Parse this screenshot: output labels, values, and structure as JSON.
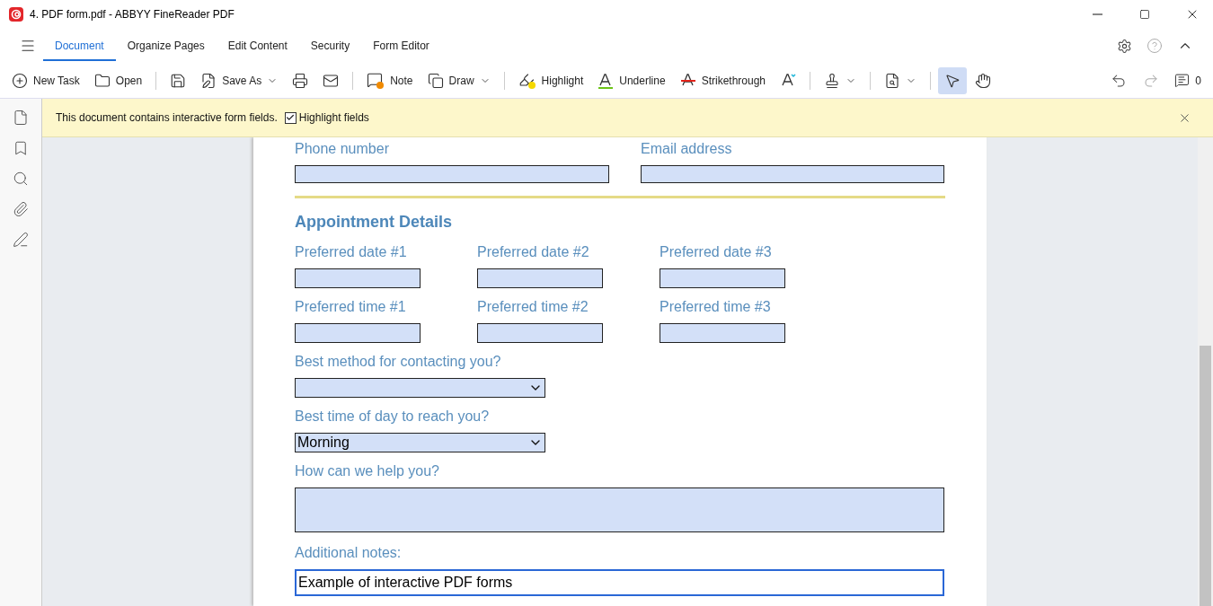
{
  "window": {
    "title": "4. PDF form.pdf - ABBYY FineReader PDF"
  },
  "tabs": [
    {
      "label": "Document",
      "selected": true
    },
    {
      "label": "Organize Pages",
      "selected": false
    },
    {
      "label": "Edit Content",
      "selected": false
    },
    {
      "label": "Security",
      "selected": false
    },
    {
      "label": "Form Editor",
      "selected": false
    }
  ],
  "toolbar": [
    {
      "kind": "button",
      "label": "New Task"
    },
    {
      "kind": "button",
      "label": "Open"
    },
    {
      "kind": "sep"
    },
    {
      "kind": "button"
    },
    {
      "kind": "button",
      "label": "Save As",
      "caret": true
    },
    {
      "kind": "button"
    },
    {
      "kind": "button"
    },
    {
      "kind": "sep"
    },
    {
      "kind": "button",
      "label": "Note"
    },
    {
      "kind": "button",
      "label": "Draw",
      "caret": true
    },
    {
      "kind": "sep"
    },
    {
      "kind": "button",
      "label": "Highlight"
    },
    {
      "kind": "button",
      "label": "Underline"
    },
    {
      "kind": "button",
      "label": "Strikethrough"
    },
    {
      "kind": "button"
    },
    {
      "kind": "sep"
    },
    {
      "kind": "button",
      "caret": true
    },
    {
      "kind": "sep"
    },
    {
      "kind": "button",
      "caret": true
    },
    {
      "kind": "sep"
    },
    {
      "kind": "button",
      "selected": true
    },
    {
      "kind": "button",
      "selected": false
    }
  ],
  "comments_count": "0",
  "banner": {
    "text": "This document contains interactive form fields.",
    "checkbox": {
      "label": "Highlight fields",
      "checked": true
    }
  },
  "form": {
    "top_fields": [
      {
        "label": "Phone number"
      },
      {
        "label": "Email address"
      }
    ],
    "section_title": "Appointment Details",
    "date_fields": [
      {
        "label": "Preferred date #1"
      },
      {
        "label": "Preferred date #2"
      },
      {
        "label": "Preferred date #3"
      }
    ],
    "time_fields": [
      {
        "label": "Preferred time #1"
      },
      {
        "label": "Preferred time #2"
      },
      {
        "label": "Preferred time #3"
      }
    ],
    "contact_method": {
      "label": "Best method for contacting you?"
    },
    "time_of_day": {
      "label": "Best time of day to reach you?",
      "value": "Morning"
    },
    "help": {
      "label": "How can we help you?"
    },
    "notes": {
      "label": "Additional notes:",
      "value": "Example of interactive PDF forms"
    }
  }
}
